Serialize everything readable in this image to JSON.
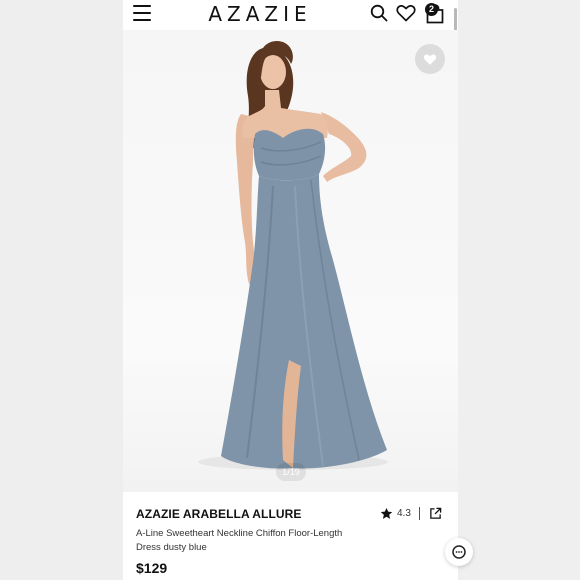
{
  "header": {
    "logo": "AZAZIE",
    "cart_count": "2",
    "icons": [
      "menu-icon",
      "search-icon",
      "heart-icon",
      "bag-icon"
    ]
  },
  "gallery": {
    "counter": "1/19",
    "dress_color": "#7f93a6"
  },
  "product": {
    "name": "AZAZIE ARABELLA ALLURE",
    "rating": "4.3",
    "description": "A-Line Sweetheart Neckline Chiffon Floor-Length Dress dusty blue",
    "price": "$129"
  }
}
